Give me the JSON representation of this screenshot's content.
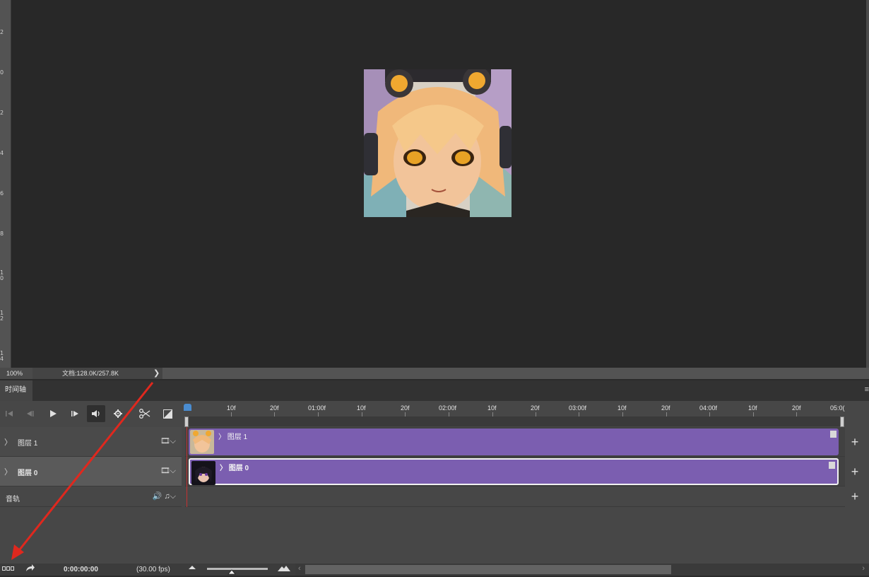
{
  "status_bar": {
    "zoom": "100%",
    "doc_info": "文档:128.0K/257.8K",
    "expand_glyph": "❯"
  },
  "vertical_ruler": {
    "ticks": [
      "2",
      "0",
      "2",
      "4",
      "6",
      "8",
      "1\n0",
      "1\n2",
      "1\n4"
    ]
  },
  "panel": {
    "tab_label": "时间轴",
    "menu_icon": "≡"
  },
  "controls": {
    "first_frame_icon": "first-frame-icon",
    "prev_frame_icon": "previous-frame-icon",
    "play_icon": "play-icon",
    "next_frame_icon": "next-frame-icon",
    "audio_icon": "audio-icon",
    "settings_icon": "gear-icon",
    "split_icon": "scissors-icon",
    "transition_icon": "transition-icon"
  },
  "ruler": {
    "labels": [
      "10f",
      "20f",
      "01:00f",
      "10f",
      "20f",
      "02:00f",
      "10f",
      "20f",
      "03:00f",
      "10f",
      "20f",
      "04:00f",
      "10f",
      "20f",
      "05:0("
    ]
  },
  "tracks": [
    {
      "name": "图层 1",
      "clip_label": "图层 1",
      "selected": false
    },
    {
      "name": "图层 0",
      "clip_label": "图层 0",
      "selected": true
    },
    {
      "name": "音轨"
    }
  ],
  "track_glyphs": {
    "chevron": "〉",
    "film": "🎞",
    "dropdown": "⌵",
    "speaker": "🔊",
    "note": "♫",
    "add": "+"
  },
  "bottom_bar": {
    "current_time": "0:00:00:00",
    "fps": "(30.00 fps)"
  },
  "colors": {
    "clip": "#7b5eb0",
    "playhead": "#4a8cd0",
    "playhead_line": "#c43131",
    "annotation_arrow": "#e0281e"
  }
}
